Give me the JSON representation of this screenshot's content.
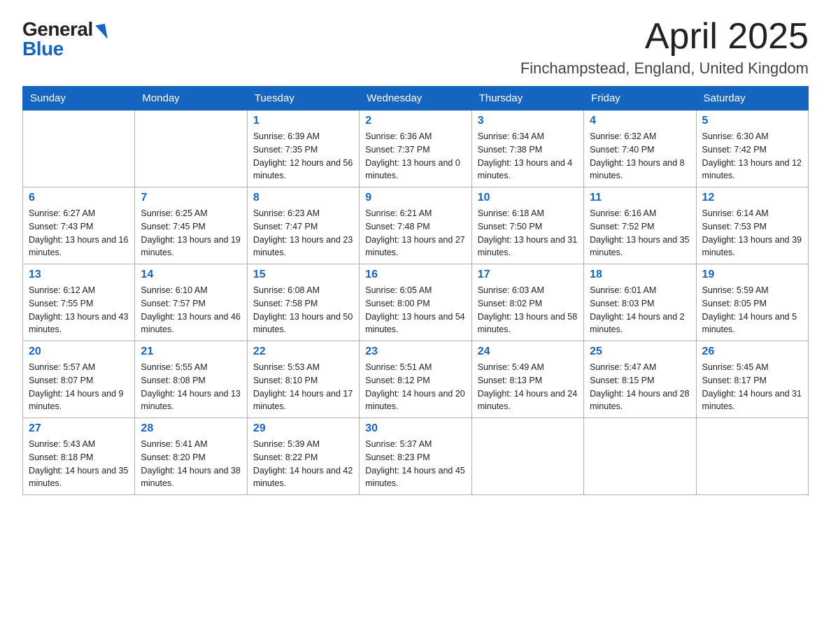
{
  "logo": {
    "general": "General",
    "blue": "Blue"
  },
  "header": {
    "month_year": "April 2025",
    "location": "Finchampstead, England, United Kingdom"
  },
  "weekdays": [
    "Sunday",
    "Monday",
    "Tuesday",
    "Wednesday",
    "Thursday",
    "Friday",
    "Saturday"
  ],
  "weeks": [
    [
      {
        "day": "",
        "sunrise": "",
        "sunset": "",
        "daylight": ""
      },
      {
        "day": "",
        "sunrise": "",
        "sunset": "",
        "daylight": ""
      },
      {
        "day": "1",
        "sunrise": "Sunrise: 6:39 AM",
        "sunset": "Sunset: 7:35 PM",
        "daylight": "Daylight: 12 hours and 56 minutes."
      },
      {
        "day": "2",
        "sunrise": "Sunrise: 6:36 AM",
        "sunset": "Sunset: 7:37 PM",
        "daylight": "Daylight: 13 hours and 0 minutes."
      },
      {
        "day": "3",
        "sunrise": "Sunrise: 6:34 AM",
        "sunset": "Sunset: 7:38 PM",
        "daylight": "Daylight: 13 hours and 4 minutes."
      },
      {
        "day": "4",
        "sunrise": "Sunrise: 6:32 AM",
        "sunset": "Sunset: 7:40 PM",
        "daylight": "Daylight: 13 hours and 8 minutes."
      },
      {
        "day": "5",
        "sunrise": "Sunrise: 6:30 AM",
        "sunset": "Sunset: 7:42 PM",
        "daylight": "Daylight: 13 hours and 12 minutes."
      }
    ],
    [
      {
        "day": "6",
        "sunrise": "Sunrise: 6:27 AM",
        "sunset": "Sunset: 7:43 PM",
        "daylight": "Daylight: 13 hours and 16 minutes."
      },
      {
        "day": "7",
        "sunrise": "Sunrise: 6:25 AM",
        "sunset": "Sunset: 7:45 PM",
        "daylight": "Daylight: 13 hours and 19 minutes."
      },
      {
        "day": "8",
        "sunrise": "Sunrise: 6:23 AM",
        "sunset": "Sunset: 7:47 PM",
        "daylight": "Daylight: 13 hours and 23 minutes."
      },
      {
        "day": "9",
        "sunrise": "Sunrise: 6:21 AM",
        "sunset": "Sunset: 7:48 PM",
        "daylight": "Daylight: 13 hours and 27 minutes."
      },
      {
        "day": "10",
        "sunrise": "Sunrise: 6:18 AM",
        "sunset": "Sunset: 7:50 PM",
        "daylight": "Daylight: 13 hours and 31 minutes."
      },
      {
        "day": "11",
        "sunrise": "Sunrise: 6:16 AM",
        "sunset": "Sunset: 7:52 PM",
        "daylight": "Daylight: 13 hours and 35 minutes."
      },
      {
        "day": "12",
        "sunrise": "Sunrise: 6:14 AM",
        "sunset": "Sunset: 7:53 PM",
        "daylight": "Daylight: 13 hours and 39 minutes."
      }
    ],
    [
      {
        "day": "13",
        "sunrise": "Sunrise: 6:12 AM",
        "sunset": "Sunset: 7:55 PM",
        "daylight": "Daylight: 13 hours and 43 minutes."
      },
      {
        "day": "14",
        "sunrise": "Sunrise: 6:10 AM",
        "sunset": "Sunset: 7:57 PM",
        "daylight": "Daylight: 13 hours and 46 minutes."
      },
      {
        "day": "15",
        "sunrise": "Sunrise: 6:08 AM",
        "sunset": "Sunset: 7:58 PM",
        "daylight": "Daylight: 13 hours and 50 minutes."
      },
      {
        "day": "16",
        "sunrise": "Sunrise: 6:05 AM",
        "sunset": "Sunset: 8:00 PM",
        "daylight": "Daylight: 13 hours and 54 minutes."
      },
      {
        "day": "17",
        "sunrise": "Sunrise: 6:03 AM",
        "sunset": "Sunset: 8:02 PM",
        "daylight": "Daylight: 13 hours and 58 minutes."
      },
      {
        "day": "18",
        "sunrise": "Sunrise: 6:01 AM",
        "sunset": "Sunset: 8:03 PM",
        "daylight": "Daylight: 14 hours and 2 minutes."
      },
      {
        "day": "19",
        "sunrise": "Sunrise: 5:59 AM",
        "sunset": "Sunset: 8:05 PM",
        "daylight": "Daylight: 14 hours and 5 minutes."
      }
    ],
    [
      {
        "day": "20",
        "sunrise": "Sunrise: 5:57 AM",
        "sunset": "Sunset: 8:07 PM",
        "daylight": "Daylight: 14 hours and 9 minutes."
      },
      {
        "day": "21",
        "sunrise": "Sunrise: 5:55 AM",
        "sunset": "Sunset: 8:08 PM",
        "daylight": "Daylight: 14 hours and 13 minutes."
      },
      {
        "day": "22",
        "sunrise": "Sunrise: 5:53 AM",
        "sunset": "Sunset: 8:10 PM",
        "daylight": "Daylight: 14 hours and 17 minutes."
      },
      {
        "day": "23",
        "sunrise": "Sunrise: 5:51 AM",
        "sunset": "Sunset: 8:12 PM",
        "daylight": "Daylight: 14 hours and 20 minutes."
      },
      {
        "day": "24",
        "sunrise": "Sunrise: 5:49 AM",
        "sunset": "Sunset: 8:13 PM",
        "daylight": "Daylight: 14 hours and 24 minutes."
      },
      {
        "day": "25",
        "sunrise": "Sunrise: 5:47 AM",
        "sunset": "Sunset: 8:15 PM",
        "daylight": "Daylight: 14 hours and 28 minutes."
      },
      {
        "day": "26",
        "sunrise": "Sunrise: 5:45 AM",
        "sunset": "Sunset: 8:17 PM",
        "daylight": "Daylight: 14 hours and 31 minutes."
      }
    ],
    [
      {
        "day": "27",
        "sunrise": "Sunrise: 5:43 AM",
        "sunset": "Sunset: 8:18 PM",
        "daylight": "Daylight: 14 hours and 35 minutes."
      },
      {
        "day": "28",
        "sunrise": "Sunrise: 5:41 AM",
        "sunset": "Sunset: 8:20 PM",
        "daylight": "Daylight: 14 hours and 38 minutes."
      },
      {
        "day": "29",
        "sunrise": "Sunrise: 5:39 AM",
        "sunset": "Sunset: 8:22 PM",
        "daylight": "Daylight: 14 hours and 42 minutes."
      },
      {
        "day": "30",
        "sunrise": "Sunrise: 5:37 AM",
        "sunset": "Sunset: 8:23 PM",
        "daylight": "Daylight: 14 hours and 45 minutes."
      },
      {
        "day": "",
        "sunrise": "",
        "sunset": "",
        "daylight": ""
      },
      {
        "day": "",
        "sunrise": "",
        "sunset": "",
        "daylight": ""
      },
      {
        "day": "",
        "sunrise": "",
        "sunset": "",
        "daylight": ""
      }
    ]
  ]
}
